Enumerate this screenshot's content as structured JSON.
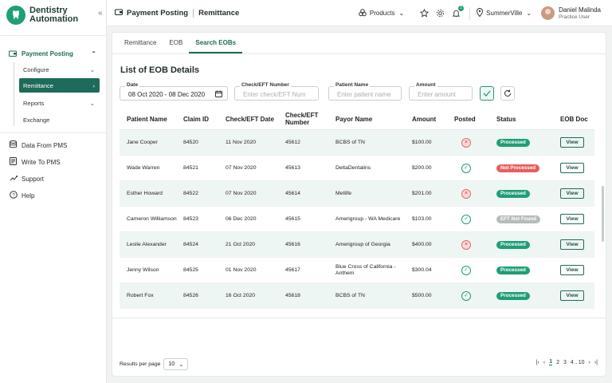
{
  "app": {
    "logo_line1": "Dentistry",
    "logo_line2": "Automation"
  },
  "sidebar": {
    "group": "Payment Posting",
    "sub_items": [
      {
        "label": "Configure",
        "has_chevron": "down"
      },
      {
        "label": "Remittance",
        "has_chevron": "right",
        "active": true
      },
      {
        "label": "Reports",
        "has_chevron": "down"
      },
      {
        "label": "Exchange"
      }
    ],
    "items": [
      {
        "label": "Data From PMS",
        "icon": "database-icon"
      },
      {
        "label": "Write To PMS",
        "icon": "write-icon"
      },
      {
        "label": "Support",
        "icon": "support-icon"
      },
      {
        "label": "Help",
        "icon": "help-icon"
      }
    ]
  },
  "topbar": {
    "title": "Payment Posting",
    "subtitle": "Remittance",
    "products_label": "Products",
    "notification_count": "1",
    "location": "SummerVille",
    "user_name": "Daniel Malinda",
    "user_role": "Practice User"
  },
  "tabs": [
    "Remittance",
    "EOB",
    "Search EOBs"
  ],
  "active_tab": "Search EOBs",
  "page_title": "List of EOB Details",
  "filters": {
    "date_label": "Date",
    "date_value": "08 Oct 2020 - 08 Dec 2020",
    "check_label": "Check/EFT Number",
    "check_placeholder": "Enter check/EFT Num",
    "patient_label": "Patient Name",
    "patient_placeholder": "Enter patient name",
    "amount_label": "Amount",
    "amount_placeholder": "Enter amount"
  },
  "table": {
    "headers": [
      "Patient Name",
      "Claim ID",
      "Check/EFT Date",
      "Check/EFT Number",
      "Payor Name",
      "Amount",
      "Posted",
      "Status",
      "EOB Doc"
    ],
    "view_label": "View",
    "rows": [
      {
        "patient": "Jane Cooper",
        "claim": "84520",
        "date": "11 Nov 2020",
        "check": "45612",
        "payor": "BCBS of TN",
        "amount": "$100.00",
        "posted": false,
        "status": "Processed",
        "status_type": "processed"
      },
      {
        "patient": "Wade Warren",
        "claim": "84521",
        "date": "07 Nov 2020",
        "check": "45613",
        "payor": "DeltaDentalins",
        "amount": "$200.00",
        "posted": true,
        "status": "Not Processed",
        "status_type": "notproc"
      },
      {
        "patient": "Esther Howard",
        "claim": "84522",
        "date": "07 Nov 2020",
        "check": "45614",
        "payor": "Metlife",
        "amount": "$201.00",
        "posted": false,
        "status": "Processed",
        "status_type": "processed"
      },
      {
        "patient": "Cameron Williamson",
        "claim": "84523",
        "date": "06 Dec 2020",
        "check": "45615",
        "payor": "Amerigroup - WA Medicare",
        "amount": "$103.00",
        "posted": true,
        "status": "EFT Not Found",
        "status_type": "notfound"
      },
      {
        "patient": "Leslie Alexander",
        "claim": "84524",
        "date": "21 Oct 2020",
        "check": "45616",
        "payor": " Amerigroup of Georgia",
        "amount": "$400.00",
        "posted": false,
        "status": "Processed",
        "status_type": "processed"
      },
      {
        "patient": "Jenny Wilson",
        "claim": "84525",
        "date": "01 Nov 2020",
        "check": "45617",
        "payor": "Blue Cross of California - Anthem",
        "amount": "$300.04",
        "posted": true,
        "status": "Processed",
        "status_type": "processed"
      },
      {
        "patient": "Robert Fox",
        "claim": "84526",
        "date": "16 Oct 2020",
        "check": "45618",
        "payor": "BCBS of TN",
        "amount": "$500.00",
        "posted": true,
        "status": "Processed",
        "status_type": "processed"
      }
    ]
  },
  "footer": {
    "rows_per_page_label": "Results per page",
    "rows_per_page_value": "10",
    "pages": [
      "1",
      "2",
      "3",
      "4",
      "..",
      "10"
    ],
    "current_page": "1"
  },
  "colors": {
    "brand": "#1f6b5a",
    "accent": "#1f9e77",
    "error": "#e85e5e"
  }
}
